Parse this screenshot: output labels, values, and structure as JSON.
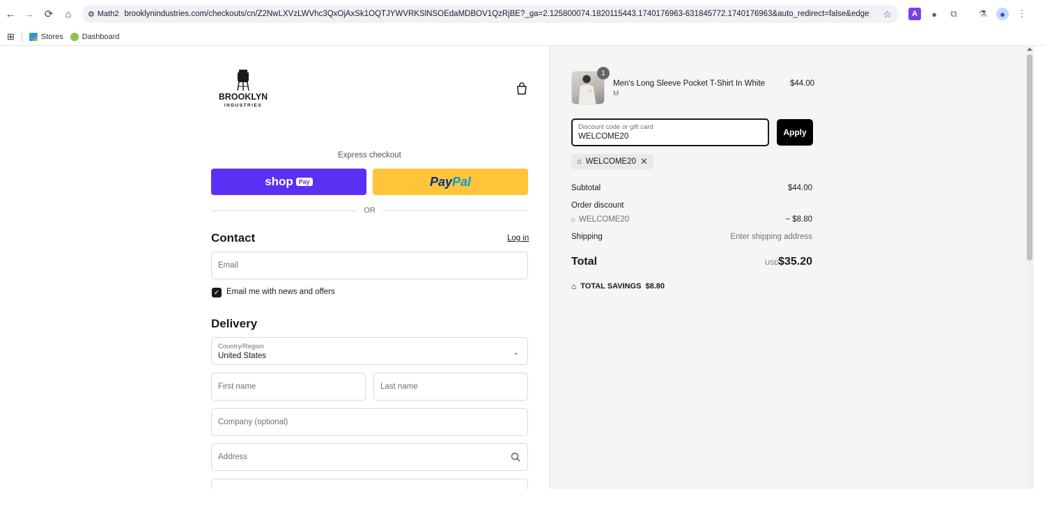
{
  "browser": {
    "site_chip": "Math2",
    "url": "brooklynindustries.com/checkouts/cn/Z2NwLXVzLWVhc3QxOjAxSk1OQTJYWVRKSlNSOEdaMDBOV1QzRjBE?_ga=2.125800074.1820115443.1740176963-631845772.1740176963&auto_redirect=false&edge_redirect=true&l...",
    "bookmarks": [
      {
        "label": "Stores"
      },
      {
        "label": "Dashboard"
      }
    ]
  },
  "store": {
    "logo_text_1": "BROOKLYN",
    "logo_text_2": "INDUSTRIES"
  },
  "checkout": {
    "express_label": "Express checkout",
    "shoppay_label": "shop",
    "shoppay_pay": "Pay",
    "paypal_1": "Pay",
    "paypal_2": "Pal",
    "or_label": "OR",
    "contact": {
      "heading": "Contact",
      "login_label": "Log in",
      "email_placeholder": "Email",
      "newsletter_label": "Email me with news and offers",
      "newsletter_checked": true
    },
    "delivery": {
      "heading": "Delivery",
      "country_label": "Country/Region",
      "country_value": "United States",
      "first_name_placeholder": "First name",
      "last_name_placeholder": "Last name",
      "company_placeholder": "Company (optional)",
      "address_placeholder": "Address"
    }
  },
  "summary": {
    "item": {
      "name": "Men's Long Sleeve Pocket T-Shirt In White",
      "variant": "M",
      "price": "$44.00",
      "quantity": "1"
    },
    "discount_label": "Discount code or gift card",
    "discount_value": "WELCOME20",
    "apply_label": "Apply",
    "applied_code": "WELCOME20",
    "subtotal_label": "Subtotal",
    "subtotal_value": "$44.00",
    "order_discount_label": "Order discount",
    "order_discount_code": "WELCOME20",
    "order_discount_value": "− $8.80",
    "shipping_label": "Shipping",
    "shipping_value": "Enter shipping address",
    "total_label": "Total",
    "total_currency": "USD",
    "total_value": "$35.20",
    "savings_label": "TOTAL SAVINGS",
    "savings_value": "$8.80"
  },
  "colors": {
    "shoppay": "#5a31f4",
    "paypal": "#ffc439",
    "apply": "#000000"
  }
}
